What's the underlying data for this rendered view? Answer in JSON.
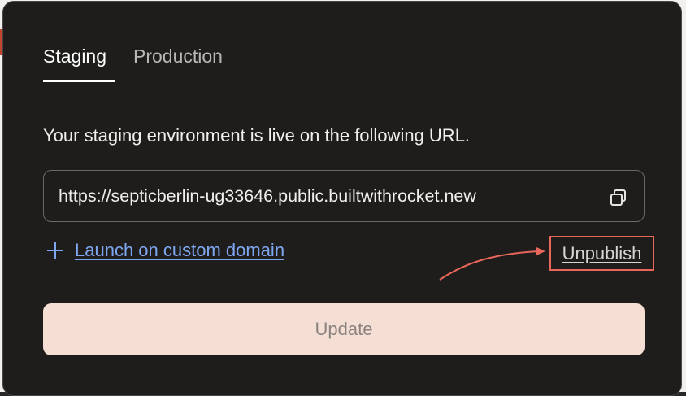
{
  "tabs": [
    {
      "label": "Staging",
      "active": true
    },
    {
      "label": "Production",
      "active": false
    }
  ],
  "staging": {
    "description": "Your staging environment is live on the following URL.",
    "url": "https://septicberlin-ug33646.public.builtwithrocket.new",
    "copy_icon": "copy-icon"
  },
  "actions": {
    "custom_domain_icon": "plus-icon",
    "custom_domain_label": "Launch on custom domain",
    "unpublish_label": "Unpublish",
    "update_label": "Update"
  },
  "colors": {
    "panel_background": "#1e1d1c",
    "link_blue": "#7fa6f0",
    "highlight_red": "#e8675a",
    "update_button_background": "#f5dfd5",
    "update_button_text": "#8a8380"
  }
}
